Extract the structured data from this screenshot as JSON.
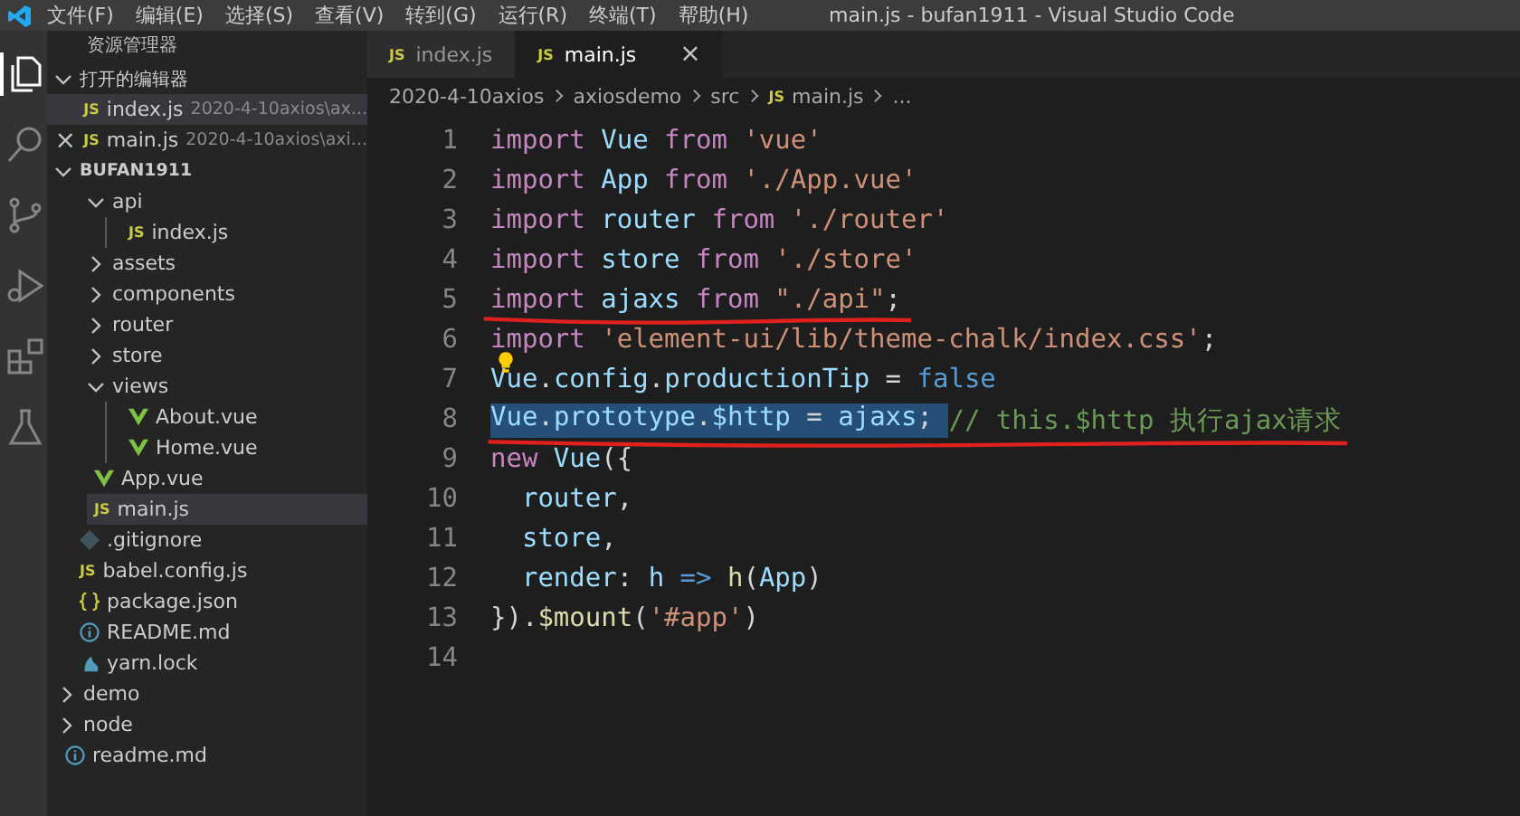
{
  "window": {
    "title": "main.js - bufan1911 - Visual Studio Code"
  },
  "menu": [
    "文件(F)",
    "编辑(E)",
    "选择(S)",
    "查看(V)",
    "转到(G)",
    "运行(R)",
    "终端(T)",
    "帮助(H)"
  ],
  "activity_bar": [
    {
      "kind": "explorer",
      "selected": true
    },
    {
      "kind": "search",
      "selected": false
    },
    {
      "kind": "source-control",
      "selected": false
    },
    {
      "kind": "run",
      "selected": false
    },
    {
      "kind": "extensions",
      "selected": false
    },
    {
      "kind": "test",
      "selected": false
    }
  ],
  "sidebar": {
    "title": "资源管理器",
    "open_editors": {
      "title": "打开的编辑器",
      "items": [
        {
          "name": "index.js",
          "badge": "JS",
          "path": "2020-4-10axios\\ax...",
          "selected": true
        },
        {
          "name": "main.js",
          "badge": "JS",
          "path": "2020-4-10axios\\axi...",
          "selected": false,
          "close": "×"
        }
      ]
    },
    "folder": {
      "title": "BUFAN1911",
      "tree": [
        {
          "kind": "group",
          "children": [
            {
              "kind": "group",
              "children": [
                {
                  "kind": "folder",
                  "name": "api",
                  "expanded": true,
                  "selected": false,
                  "children": [
                    {
                      "kind": "js",
                      "badge": "JS",
                      "name": "index.js",
                      "selected": false
                    }
                  ]
                },
                {
                  "kind": "folder",
                  "name": "assets",
                  "expanded": false,
                  "selected": false
                },
                {
                  "kind": "folder",
                  "name": "components",
                  "expanded": false,
                  "selected": false
                },
                {
                  "kind": "folder",
                  "name": "router",
                  "expanded": false,
                  "selected": false
                },
                {
                  "kind": "folder",
                  "name": "store",
                  "expanded": false,
                  "selected": false
                },
                {
                  "kind": "folder",
                  "name": "views",
                  "expanded": true,
                  "selected": false,
                  "children": [
                    {
                      "kind": "vue",
                      "name": "About.vue",
                      "selected": false
                    },
                    {
                      "kind": "vue",
                      "name": "Home.vue",
                      "selected": false
                    }
                  ]
                },
                {
                  "kind": "vue",
                  "name": "App.vue",
                  "selected": false
                },
                {
                  "kind": "js",
                  "badge": "JS",
                  "name": "main.js",
                  "selected": true
                }
              ]
            },
            {
              "kind": "git",
              "name": ".gitignore",
              "selected": false
            },
            {
              "kind": "js",
              "badge": "JS",
              "name": "babel.config.js",
              "selected": false
            },
            {
              "kind": "json",
              "name": "package.json",
              "selected": false
            },
            {
              "kind": "info",
              "name": "README.md",
              "selected": false
            },
            {
              "kind": "yarn",
              "name": "yarn.lock",
              "selected": false
            }
          ]
        },
        {
          "kind": "folder",
          "name": "demo",
          "expanded": false,
          "selected": false
        },
        {
          "kind": "folder",
          "name": "node",
          "expanded": false,
          "selected": false
        },
        {
          "kind": "info",
          "name": "readme.md",
          "selected": false
        }
      ]
    }
  },
  "tabs": [
    {
      "name": "index.js",
      "badge": "JS",
      "selected": false
    },
    {
      "name": "main.js",
      "badge": "JS",
      "selected": true,
      "close": "×"
    }
  ],
  "breadcrumb": [
    {
      "kind": "folder",
      "text": "2020-4-10axios"
    },
    {
      "kind": "folder",
      "text": "axiosdemo"
    },
    {
      "kind": "folder",
      "text": "src"
    },
    {
      "kind": "js",
      "badge": "JS",
      "text": "main.js"
    },
    {
      "kind": "more",
      "text": "..."
    }
  ],
  "code": [
    {
      "number": "1",
      "tokens": [
        {
          "kind": "kw",
          "text": "import"
        },
        {
          "kind": "var",
          "text": " Vue "
        },
        {
          "kind": "kw",
          "text": "from"
        },
        {
          "kind": "str",
          "text": " 'vue'"
        }
      ]
    },
    {
      "number": "2",
      "tokens": [
        {
          "kind": "kw",
          "text": "import"
        },
        {
          "kind": "var",
          "text": " App "
        },
        {
          "kind": "kw",
          "text": "from"
        },
        {
          "kind": "str",
          "text": " './App.vue'"
        }
      ]
    },
    {
      "number": "3",
      "tokens": [
        {
          "kind": "kw",
          "text": "import"
        },
        {
          "kind": "var",
          "text": " router "
        },
        {
          "kind": "kw",
          "text": "from"
        },
        {
          "kind": "str",
          "text": " './router'"
        }
      ]
    },
    {
      "number": "4",
      "tokens": [
        {
          "kind": "kw",
          "text": "import"
        },
        {
          "kind": "var",
          "text": " store "
        },
        {
          "kind": "kw",
          "text": "from"
        },
        {
          "kind": "str",
          "text": " './store'"
        }
      ]
    },
    {
      "number": "5",
      "underlined": true,
      "tokens": [
        {
          "kind": "kw",
          "text": "import"
        },
        {
          "kind": "var",
          "text": " ajaxs "
        },
        {
          "kind": "kw",
          "text": "from"
        },
        {
          "kind": "str",
          "text": " \"./api\""
        },
        {
          "kind": "punct",
          "text": ";"
        }
      ]
    },
    {
      "number": "6",
      "tokens": [
        {
          "kind": "kw",
          "text": "import"
        },
        {
          "kind": "str",
          "text": " 'element-ui/lib/theme-chalk/index.css'"
        },
        {
          "kind": "punct",
          "text": ";"
        }
      ]
    },
    {
      "number": "7",
      "lightbulb": true,
      "tokens": [
        {
          "kind": "var",
          "text": "Vue"
        },
        {
          "kind": "punct",
          "text": "."
        },
        {
          "kind": "var",
          "text": "config"
        },
        {
          "kind": "punct",
          "text": "."
        },
        {
          "kind": "var",
          "text": "productionTip"
        },
        {
          "kind": "punct",
          "text": " = "
        },
        {
          "kind": "const",
          "text": "false"
        }
      ]
    },
    {
      "number": "8",
      "underlined": true,
      "selection": [
        {
          "kind": "var",
          "text": "Vue"
        },
        {
          "kind": "punct",
          "text": "."
        },
        {
          "kind": "var",
          "text": "prototype"
        },
        {
          "kind": "punct",
          "text": "."
        },
        {
          "kind": "var",
          "text": "$http"
        },
        {
          "kind": "punct",
          "text": " = "
        },
        {
          "kind": "var",
          "text": "ajaxs"
        },
        {
          "kind": "punct",
          "text": "; "
        }
      ],
      "tokens": [
        {
          "kind": "comment",
          "text": "// this.$http 执行ajax请求"
        }
      ]
    },
    {
      "number": "9",
      "tokens": [
        {
          "kind": "kw",
          "text": "new"
        },
        {
          "kind": "var",
          "text": " Vue"
        },
        {
          "kind": "punct",
          "text": "({"
        }
      ]
    },
    {
      "number": "10",
      "tokens": [
        {
          "kind": "var",
          "text": "  router"
        },
        {
          "kind": "punct",
          "text": ","
        }
      ]
    },
    {
      "number": "11",
      "tokens": [
        {
          "kind": "var",
          "text": "  store"
        },
        {
          "kind": "punct",
          "text": ","
        }
      ]
    },
    {
      "number": "12",
      "tokens": [
        {
          "kind": "var",
          "text": "  render"
        },
        {
          "kind": "punct",
          "text": ": "
        },
        {
          "kind": "var",
          "text": "h"
        },
        {
          "kind": "const",
          "text": " => "
        },
        {
          "kind": "fn",
          "text": "h"
        },
        {
          "kind": "punct",
          "text": "("
        },
        {
          "kind": "var",
          "text": "App"
        },
        {
          "kind": "punct",
          "text": ")"
        }
      ]
    },
    {
      "number": "13",
      "tokens": [
        {
          "kind": "punct",
          "text": "})."
        },
        {
          "kind": "fn",
          "text": "$mount"
        },
        {
          "kind": "punct",
          "text": "("
        },
        {
          "kind": "str",
          "text": "'#app'"
        },
        {
          "kind": "punct",
          "text": ")"
        }
      ]
    },
    {
      "number": "14"
    }
  ]
}
